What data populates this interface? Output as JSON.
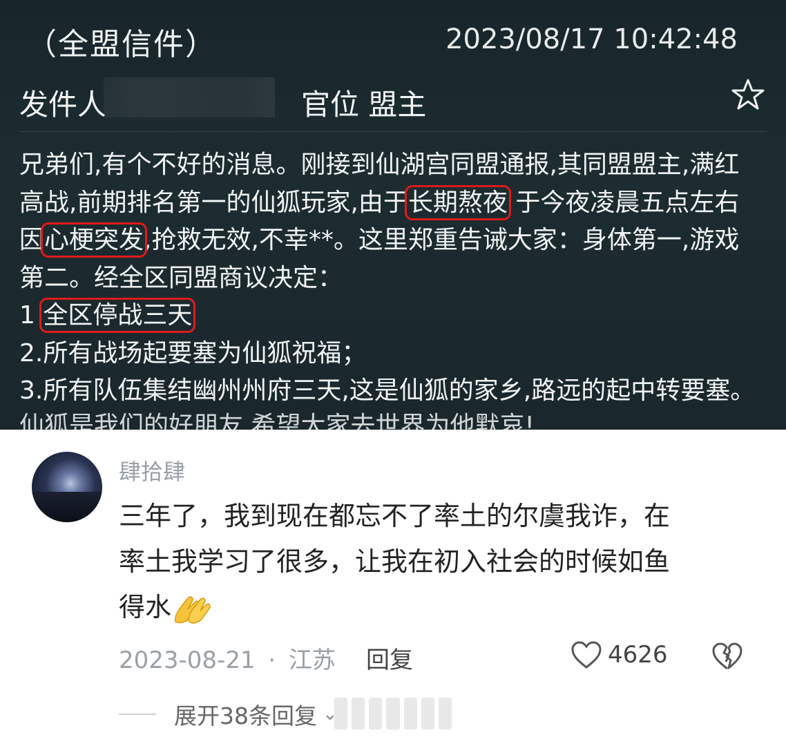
{
  "mail": {
    "title": "（全盟信件）",
    "timestamp": "2023/08/17 10:42:48",
    "sender_label": "发件人",
    "rank": "官位 盟主",
    "lines": [
      {
        "segments": [
          {
            "t": "兄弟们,有个不好的消息。刚接到仙湖宫同盟通报,其同盟盟主,满红"
          }
        ]
      },
      {
        "segments": [
          {
            "t": "高战,前期排名第一的仙狐玩家,由于"
          },
          {
            "t": "长期熬夜",
            "hl": true
          },
          {
            "t": " 于今夜凌晨五点左右"
          }
        ]
      },
      {
        "segments": [
          {
            "t": "因"
          },
          {
            "t": "心梗突发",
            "hl": true
          },
          {
            "t": ",抢救无效,不幸**。这里郑重告诫大家：身体第一,游戏"
          }
        ]
      },
      {
        "segments": [
          {
            "t": "第二。经全区同盟商议决定："
          }
        ]
      },
      {
        "segments": [
          {
            "t": "1 "
          },
          {
            "t": "全区停战三天",
            "hl": true
          }
        ]
      },
      {
        "segments": [
          {
            "t": "2.所有战场起要塞为仙狐祝福；"
          }
        ]
      },
      {
        "segments": [
          {
            "t": "3.所有队伍集结幽州州府三天,这是仙狐的家乡,路远的起中转要塞。"
          }
        ]
      }
    ],
    "cut_line": "仙狐是我们的好朋友,希望大家去世界为他默哀!"
  },
  "comment": {
    "username": "肆拾肆",
    "text_lines": [
      "三年了，我到现在都忘不了率土的尔虞我诈，在",
      "率土我学习了很多，让我在初入社会的时候如鱼",
      "得水"
    ],
    "emoji": "pray-hands",
    "date": "2023-08-21",
    "separator": "·",
    "location": "江苏",
    "reply_label": "回复",
    "like_count": "4626",
    "expand_label": "展开38条回复"
  },
  "colors": {
    "highlight": "#e01a1a",
    "mail_bg": "#1b292e",
    "muted": "#9aa0a6"
  }
}
